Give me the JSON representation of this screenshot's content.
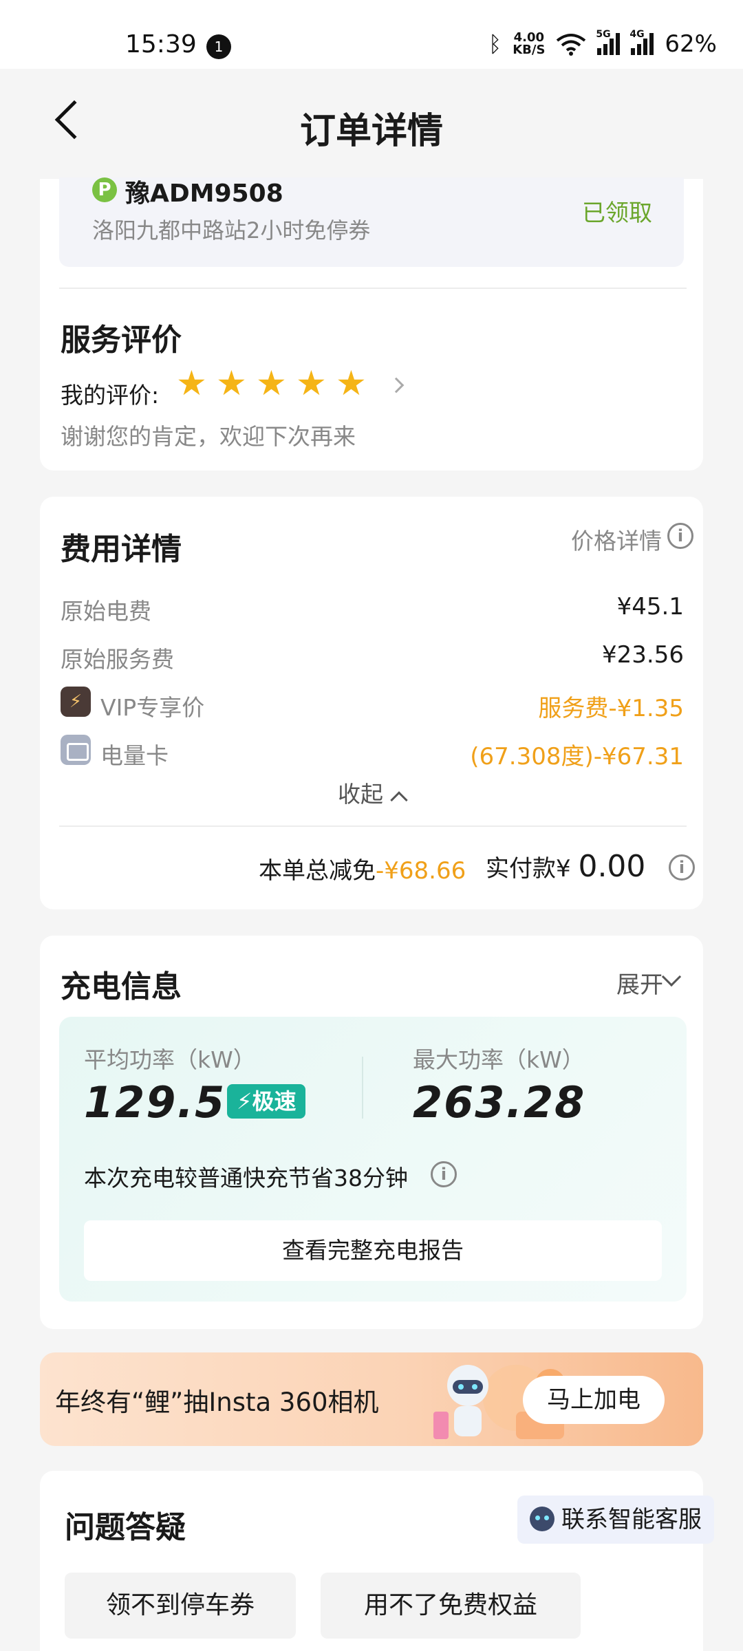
{
  "status_bar": {
    "time": "15:39",
    "notification_count": "1",
    "speed_value": "4.00",
    "speed_unit": "KB/S",
    "network_1": "5G",
    "network_2": "4G",
    "battery": "62%"
  },
  "header": {
    "title": "订单详情"
  },
  "coupon": {
    "plate": "豫ADM9508",
    "description": "洛阳九都中路站2小时免停券",
    "status": "已领取",
    "status_color": "#6ba62c"
  },
  "service_rating": {
    "title": "服务评价",
    "label": "我的评价:",
    "stars": 5,
    "thanks": "谢谢您的肯定，欢迎下次再来"
  },
  "fees": {
    "title": "费用详情",
    "price_detail_link": "价格详情",
    "rows": [
      {
        "label": "原始电费",
        "value": "¥45.1"
      },
      {
        "label": "原始服务费",
        "value": "¥23.56"
      },
      {
        "label": "VIP专享价",
        "value": "服务费-¥1.35"
      },
      {
        "label": "电量卡",
        "value": "(67.308度)-¥67.31"
      }
    ],
    "collapse_label": "收起",
    "total_discount_label": "本单总减免",
    "total_discount_value": "-¥68.66",
    "paid_label": "实付款¥",
    "paid_value": "0.00",
    "accent_color": "#f0a019"
  },
  "charging": {
    "title": "充电信息",
    "expand_label": "展开",
    "avg_power_label": "平均功率（kW）",
    "avg_power_value": "129.56",
    "fast_badge": "极速",
    "max_power_label": "最大功率（kW）",
    "max_power_value": "263.28",
    "save_note": "本次充电较普通快充节省38分钟",
    "report_button": "查看完整充电报告"
  },
  "banner": {
    "text": "年终有“鲤”抽Insta 360相机",
    "button": "马上加电"
  },
  "faq": {
    "title": "问题答疑",
    "ai_service": "联系智能客服",
    "chips": [
      "领不到停车券",
      "用不了免费权益"
    ]
  }
}
